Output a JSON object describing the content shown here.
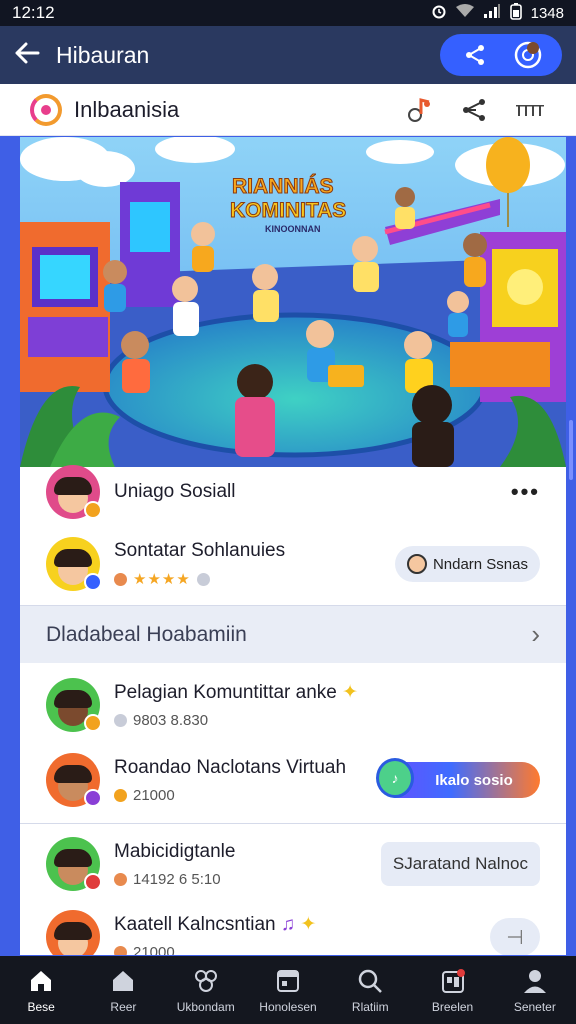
{
  "status_bar": {
    "time": "12:12",
    "battery": "1348"
  },
  "app_bar": {
    "title": "Hibauran"
  },
  "sub_header": {
    "brand": "Inlbaanisia"
  },
  "hero": {
    "title_line1": "RIANNIÁS",
    "title_line2": "KOMINITAS",
    "subtitle": "KINOONNAN"
  },
  "community_rows": [
    {
      "title": "Uniago Sosiall"
    },
    {
      "title": "Sontatar Sohlanuies",
      "chip_label": "Nndarn Ssnas"
    }
  ],
  "section": {
    "title": "Dladabeal Hoabamiin"
  },
  "activities": [
    {
      "title": "Pelagian Komuntittar anke",
      "meta": "9803 8.830"
    },
    {
      "title": "Roandao Naclotans Virtuah",
      "meta": "21000",
      "button_label": "Ikalo sosio"
    },
    {
      "title": "Mabicidigtanle",
      "meta": "14192 6 5:10",
      "button_label": "SJaratand Nalnoc"
    },
    {
      "title": "Kaatell Kalncsntian",
      "meta": "21000"
    }
  ],
  "bottom_nav": [
    {
      "label": "Bese",
      "icon": "home-icon"
    },
    {
      "label": "Reer",
      "icon": "home-outline-icon"
    },
    {
      "label": "Ukbondam",
      "icon": "community-icon"
    },
    {
      "label": "Honolesen",
      "icon": "calendar-icon"
    },
    {
      "label": "Rlatiim",
      "icon": "search-icon"
    },
    {
      "label": "Breelen",
      "icon": "notification-icon"
    },
    {
      "label": "Seneter",
      "icon": "profile-icon"
    }
  ],
  "colors": {
    "accent": "#3560ff",
    "app_bar": "#2a3960",
    "background": "#3f5fe6",
    "star": "#f5a623"
  }
}
